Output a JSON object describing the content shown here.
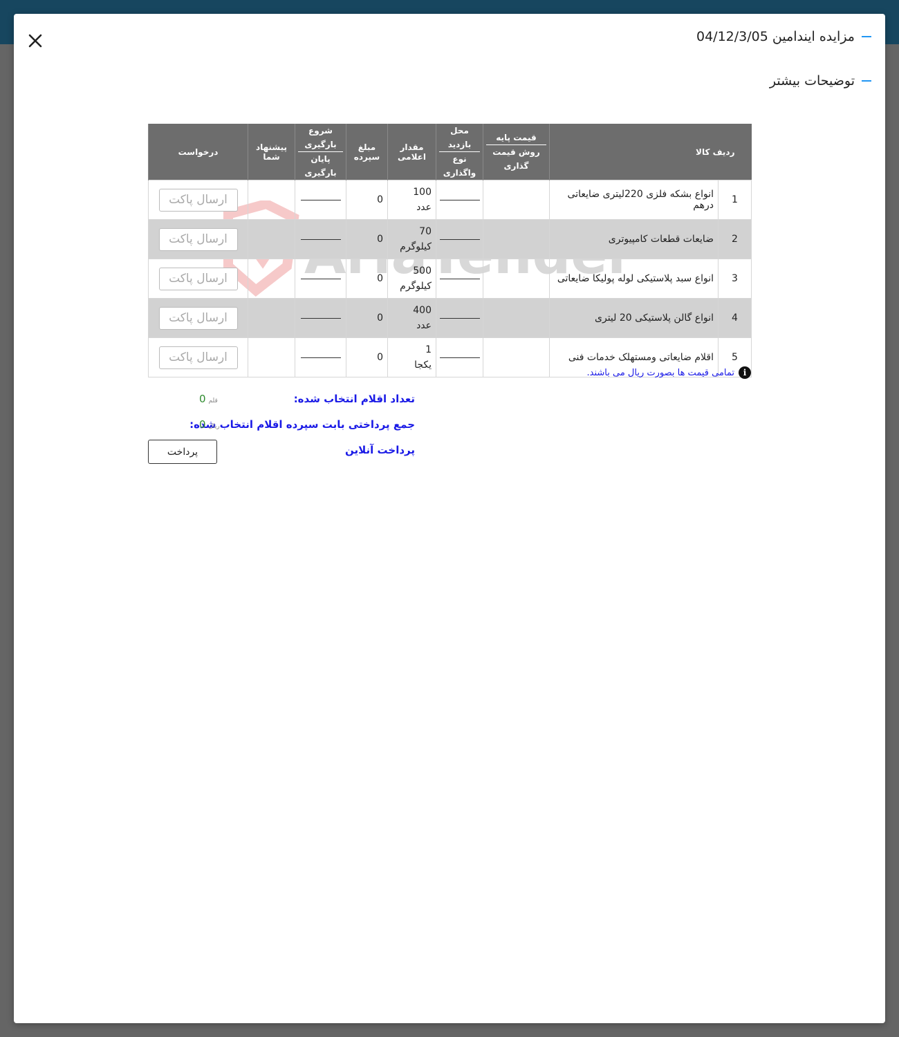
{
  "modal": {
    "title": "مزایده ایندامین 04/12/3/05",
    "subtitle": "توضیحات بیشتر"
  },
  "table": {
    "headers": {
      "row_item": "ردیف کالا",
      "base_price": "قیمت پایه",
      "pricing_method": "روش قیمت گذاری",
      "visit_place": "محل بازدید",
      "assignment_type": "نوع واگذاری",
      "declared_amount": "مقدار اعلامی",
      "deposit_amount": "مبلغ سپرده",
      "loading_start": "شروع بارگیری",
      "loading_end": "پایان بارگیری",
      "your_offer": "پیشنهاد شما",
      "request": "درخواست"
    },
    "rows": [
      {
        "index": "1",
        "title": "انواع بشکه فلزی 220لیتری ضایعاتی درهم",
        "qty": "100",
        "unit": "عدد",
        "deposit": "0",
        "button": "ارسال پاکت"
      },
      {
        "index": "2",
        "title": "ضایعات قطعات کامپیوتری",
        "qty": "70",
        "unit": "کیلوگرم",
        "deposit": "0",
        "button": "ارسال پاکت"
      },
      {
        "index": "3",
        "title": "انواع سبد پلاستیکی لوله پولیکا ضایعاتی",
        "qty": "500",
        "unit": "کیلوگرم",
        "deposit": "0",
        "button": "ارسال پاکت"
      },
      {
        "index": "4",
        "title": "انواع گالن پلاستیکی 20 لیتری",
        "qty": "400",
        "unit": "عدد",
        "deposit": "0",
        "button": "ارسال پاکت"
      },
      {
        "index": "5",
        "title": "اقلام ضایعاتی ومستهلک خدمات فنی",
        "qty": "1",
        "unit": "یکجا",
        "deposit": "0",
        "button": "ارسال پاکت"
      }
    ]
  },
  "note": "تمامی قیمت ها بصورت ریال می باشند.",
  "summary": {
    "selected_count_label": "تعداد اقلام انتخاب شده:",
    "selected_count_value": "0",
    "selected_count_unit": "قلم",
    "total_label": "جمع پرداختی بابت سپرده اقلام انتخاب شده:",
    "total_value": "0",
    "total_unit": "ریال",
    "online_payment_label": "پرداخت آنلاین",
    "pay_button": "پرداخت"
  },
  "watermark": "AriaTender.neT",
  "colors": {
    "header_bg": "#6d6d6d",
    "accent": "#2196f3",
    "link_blue": "#1a1ae6",
    "value_green": "#2e8b2e",
    "top_bar": "#17465f"
  }
}
